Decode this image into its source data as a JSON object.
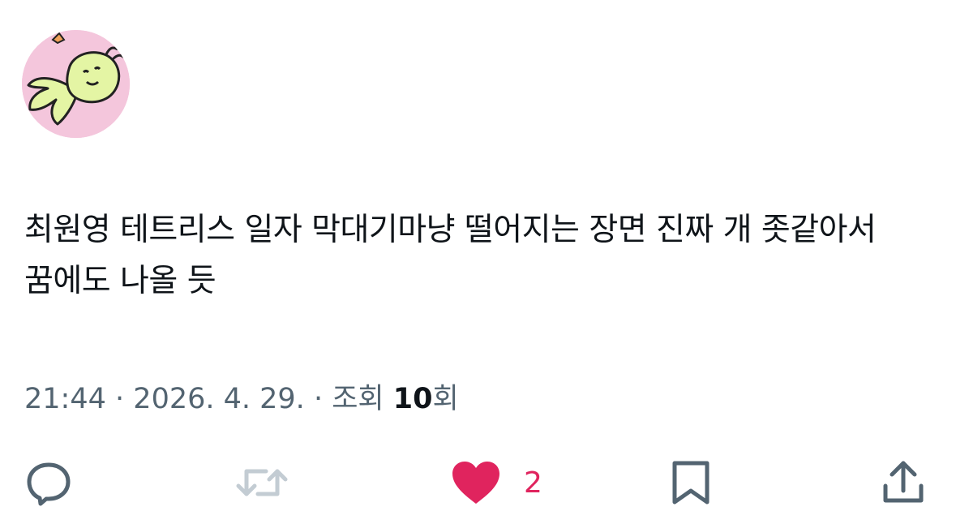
{
  "post": {
    "text": "최원영 테트리스 일자 막대기마냥 떨어지는 장면 진짜 개 좃같아서 꿈에도 나올 듯",
    "time": "21:44",
    "date": "2026. 4. 29.",
    "separator": "·",
    "views_label": "조회",
    "views_count": "10",
    "views_unit": "회"
  },
  "actions": {
    "reply_icon": "reply-icon",
    "repost_icon": "repost-icon",
    "like_icon": "heart-icon",
    "like_count": "2",
    "bookmark_icon": "bookmark-icon",
    "share_icon": "share-icon"
  },
  "colors": {
    "text_primary": "#0f1419",
    "text_secondary": "#536471",
    "like_active": "#e0245e",
    "icon_gray": "#536471",
    "icon_disabled": "#c3ccd3",
    "avatar_bg": "#f4c6dc",
    "avatar_figure": "#e4f5a4"
  }
}
